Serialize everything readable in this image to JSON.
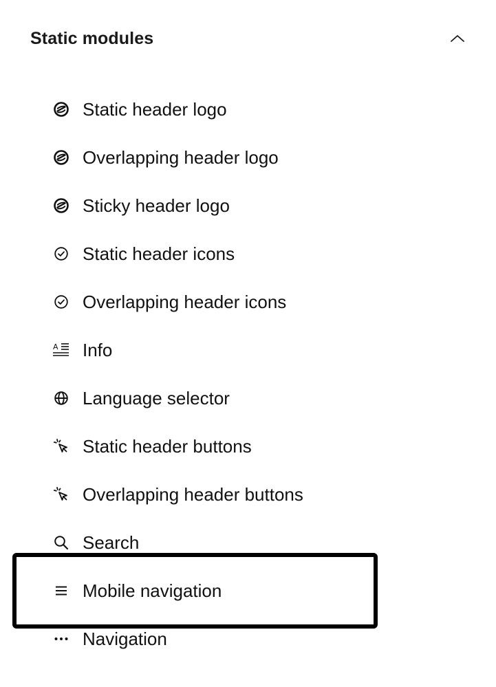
{
  "section": {
    "title": "Static modules",
    "toggle_icon": "chevron-up-icon"
  },
  "items": [
    {
      "label": "Static header logo",
      "icon": "logo-icon"
    },
    {
      "label": "Overlapping header logo",
      "icon": "logo-icon"
    },
    {
      "label": "Sticky header logo",
      "icon": "logo-icon"
    },
    {
      "label": "Static header icons",
      "icon": "check-circle-icon"
    },
    {
      "label": "Overlapping header icons",
      "icon": "check-circle-icon"
    },
    {
      "label": "Info",
      "icon": "text-info-icon"
    },
    {
      "label": "Language selector",
      "icon": "globe-icon"
    },
    {
      "label": "Static header buttons",
      "icon": "cursor-click-icon"
    },
    {
      "label": "Overlapping header buttons",
      "icon": "cursor-click-icon"
    },
    {
      "label": "Search",
      "icon": "search-icon"
    },
    {
      "label": "Mobile navigation",
      "icon": "hamburger-menu-icon"
    },
    {
      "label": "Navigation",
      "icon": "ellipsis-icon"
    }
  ],
  "highlighted_item": "Mobile navigation",
  "colors": {
    "text": "#111111",
    "highlight_border": "#000000",
    "background": "#ffffff"
  }
}
